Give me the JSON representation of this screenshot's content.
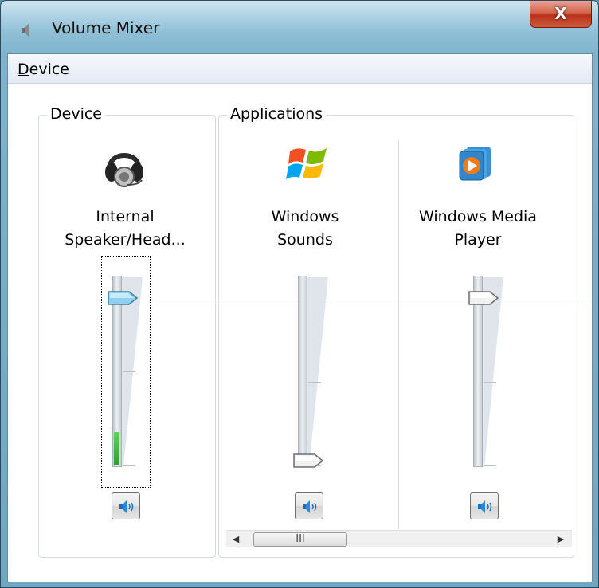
{
  "window": {
    "title": "Volume Mixer",
    "close_label": "X",
    "icon": "speaker-icon"
  },
  "menu": {
    "items": [
      {
        "label": "Device",
        "accel": "D",
        "rest": "evice"
      }
    ]
  },
  "device_group": {
    "label": "Device",
    "channel": {
      "line1": "Internal",
      "line2": "Speaker/Head...",
      "icon": "headphones-icon",
      "volume_percent": 88,
      "peak_percent": 18,
      "mute_icon": "speaker-icon"
    }
  },
  "applications_group": {
    "label": "Applications",
    "channels": [
      {
        "line1": "Windows",
        "line2": "Sounds",
        "icon": "windows-logo-icon",
        "volume_percent": 0,
        "mute_icon": "speaker-icon"
      },
      {
        "line1": "Windows Media",
        "line2": "Player",
        "icon": "media-player-icon",
        "volume_percent": 88,
        "mute_icon": "speaker-icon"
      }
    ],
    "scrollbar": {
      "left_arrow": "◀",
      "right_arrow": "▶",
      "grip": "III"
    }
  }
}
